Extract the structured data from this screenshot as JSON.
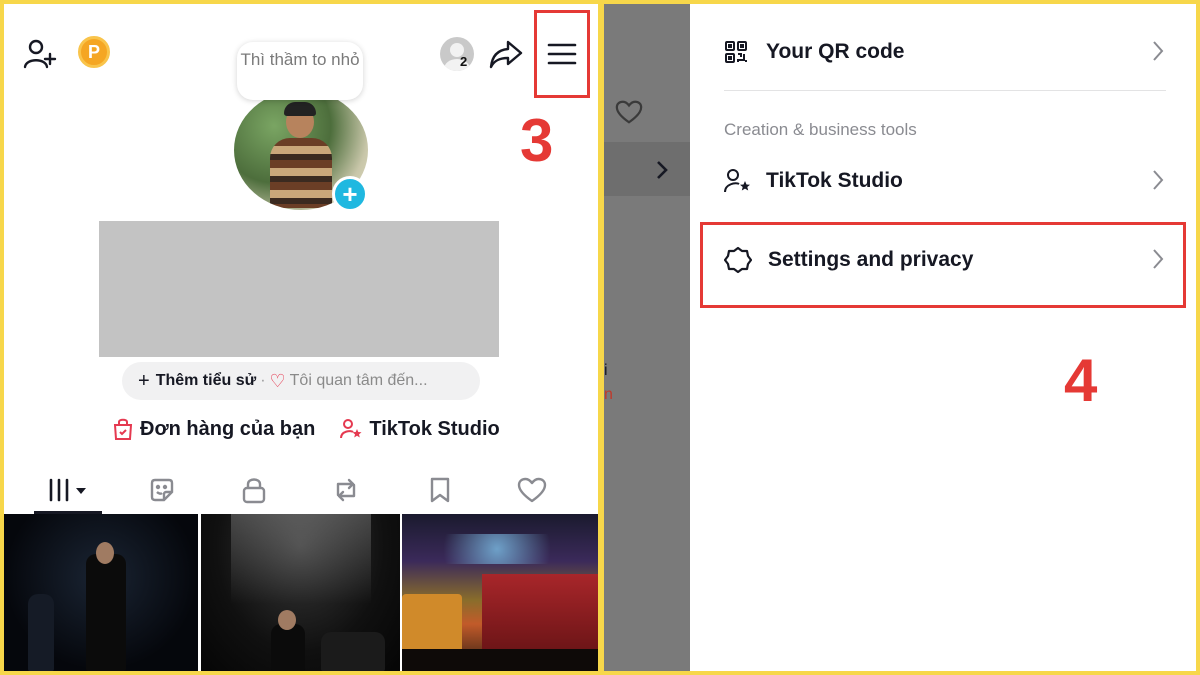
{
  "left": {
    "coin_letter": "P",
    "follower_requests_count": "2",
    "step_label": "3",
    "status_bubble": "Thì thầm to nhỏ",
    "bio": {
      "add_bio": "Thêm tiểu sử",
      "separator": "·",
      "interests_placeholder": "Tôi quan tâm đến..."
    },
    "links": [
      {
        "label": "Đơn hàng của bạn",
        "icon": "shopping-bag-icon"
      },
      {
        "label": "TikTok Studio",
        "icon": "creator-star-icon"
      }
    ],
    "tabs": [
      {
        "icon": "videos-grid-icon",
        "active": true
      },
      {
        "icon": "sticker-icon",
        "active": false
      },
      {
        "icon": "lock-icon",
        "active": false
      },
      {
        "icon": "repost-icon",
        "active": false
      },
      {
        "icon": "bookmark-icon",
        "active": false
      },
      {
        "icon": "heart-icon",
        "active": false
      }
    ]
  },
  "right": {
    "step_label": "4",
    "menu": {
      "qr_code": "Your QR code",
      "section_title": "Creation & business tools",
      "tiktok_studio": "TikTok Studio",
      "settings": "Settings and privacy"
    }
  },
  "colors": {
    "frame": "#f7d74a",
    "highlight": "#e53935",
    "accent_blue": "#20b8e0",
    "heart_red": "#e53950"
  }
}
